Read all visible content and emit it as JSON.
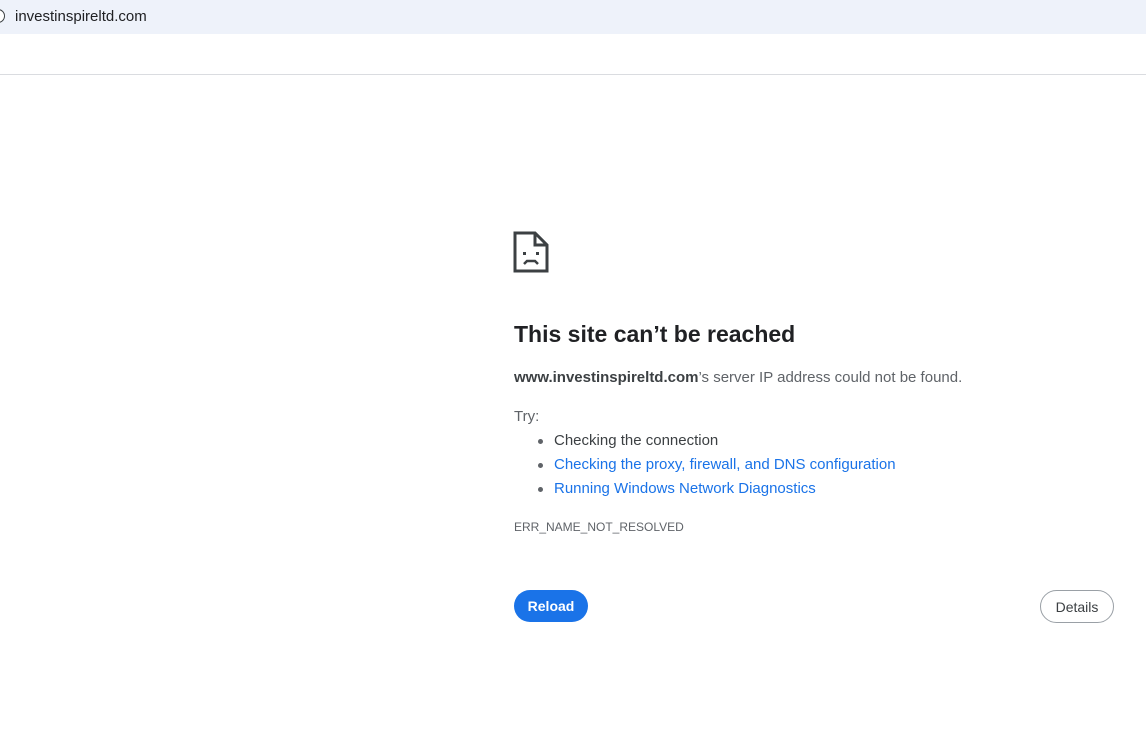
{
  "browser": {
    "url": "investinspireltd.com",
    "site_info_icon": "site-info-icon"
  },
  "error_page": {
    "icon": "sad-page-icon",
    "title": "This site can’t be reached",
    "summary_domain": "www.investinspireltd.com",
    "summary_rest": "’s server IP address could not be found.",
    "try_label": "Try:",
    "suggestions": [
      {
        "text": "Checking the connection",
        "is_link": false
      },
      {
        "text": "Checking the proxy, firewall, and DNS configuration",
        "is_link": true
      },
      {
        "text": "Running Windows Network Diagnostics",
        "is_link": true
      }
    ],
    "error_code": "ERR_NAME_NOT_RESOLVED",
    "reload_label": "Reload",
    "details_label": "Details"
  },
  "colors": {
    "accent": "#1a73e8",
    "address_bar_bg": "#eef2fa",
    "title_text": "#202124",
    "body_text": "#5f6368"
  }
}
